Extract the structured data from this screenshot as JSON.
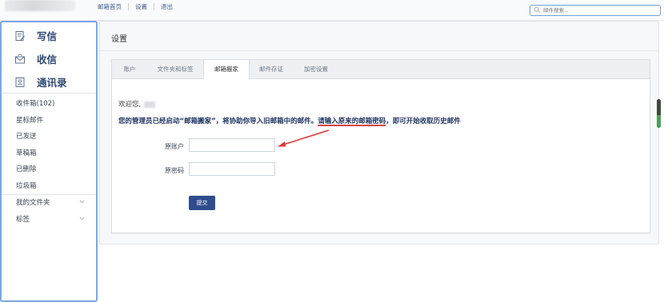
{
  "topbar": {
    "links": [
      "邮箱首页",
      "设置",
      "退出"
    ],
    "search_placeholder": "邮件搜索..."
  },
  "sidebar": {
    "actions": [
      {
        "label": "写信",
        "icon": "compose-icon"
      },
      {
        "label": "收信",
        "icon": "inbox-icon"
      },
      {
        "label": "通讯录",
        "icon": "contacts-icon"
      }
    ],
    "folders": [
      "收件箱(102)",
      "星标邮件",
      "已发送",
      "草稿箱",
      "已删除",
      "垃圾箱"
    ],
    "groups": [
      "我的文件夹",
      "标签"
    ]
  },
  "settings": {
    "title": "设置",
    "tabs": [
      "账户",
      "文件夹和标签",
      "邮箱搬家",
      "邮件存证",
      "加密设置"
    ],
    "active_tab": "邮箱搬家",
    "welcome": "欢迎您,",
    "notice_part1": "您的管理员已经启动“邮箱搬家”，将协助你导入旧邮箱中的邮件。",
    "notice_highlight": "请输入原来的邮箱密码",
    "notice_part2": "，即可开始收取历史邮件",
    "account_label": "原账户",
    "password_label": "原密码",
    "account_value": "",
    "password_value": "",
    "submit_label": "提交"
  },
  "colors": {
    "accent_border": "#7aa7e6",
    "submit_bg": "#2f4d8d",
    "annotation_arrow": "#e03b3b",
    "notice_text": "#1b2f5e"
  }
}
